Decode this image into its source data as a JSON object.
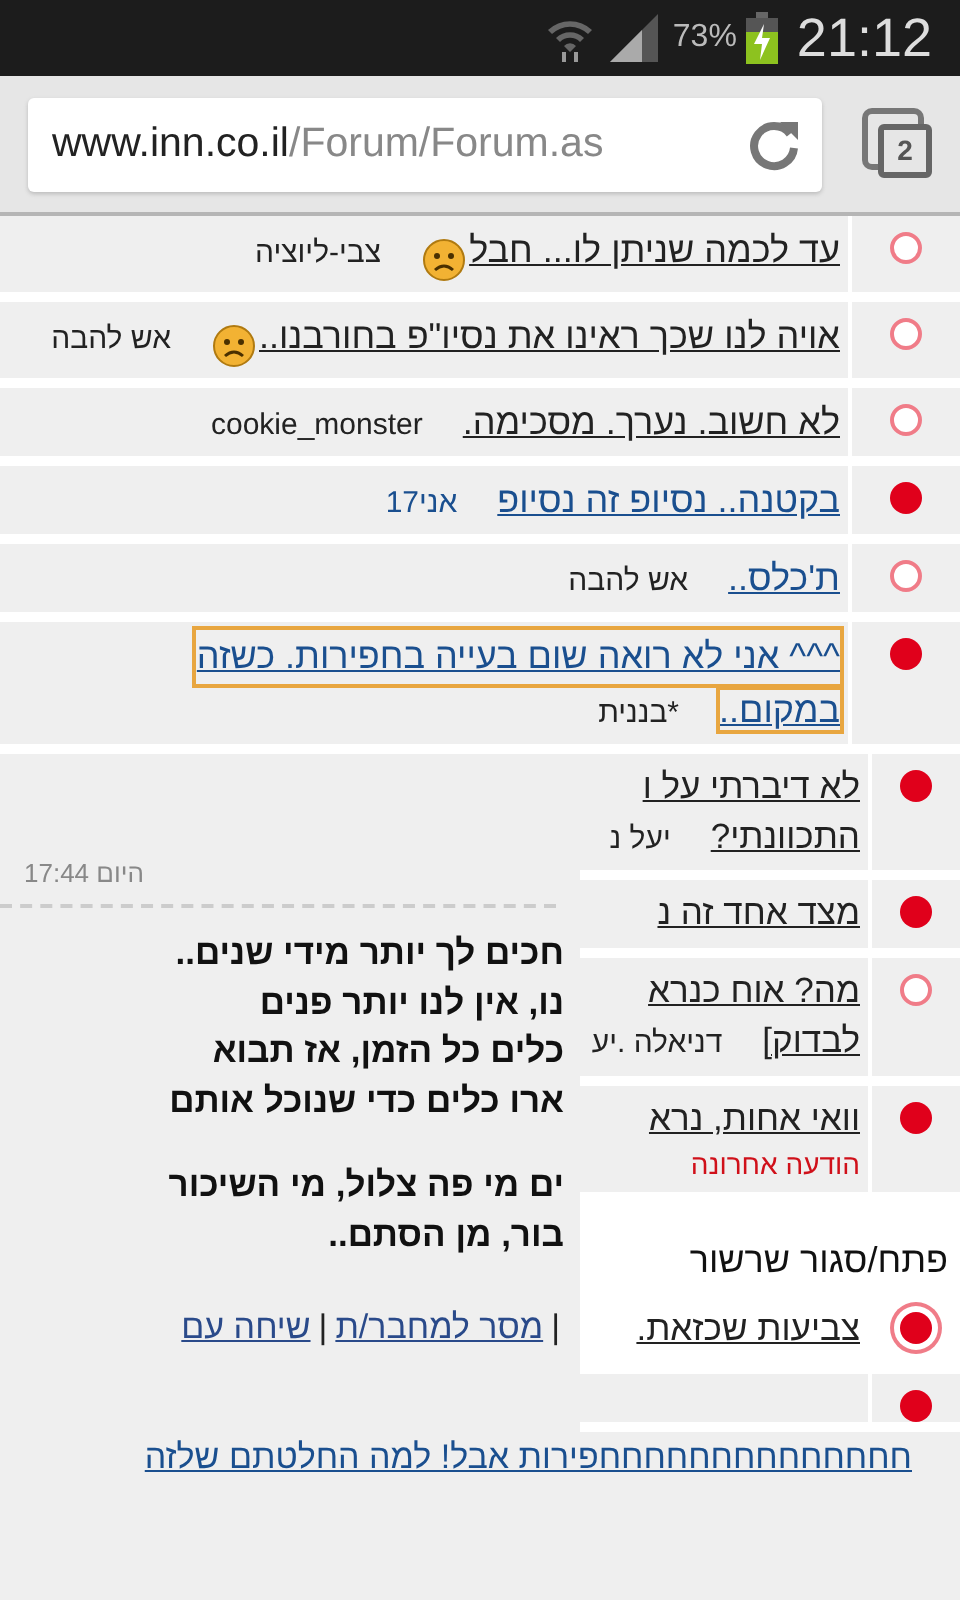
{
  "status_bar": {
    "battery": "73%",
    "time": "21:12"
  },
  "browser": {
    "url_host": "www.inn.co.il",
    "url_path": "/Forum/Forum.as",
    "tab_count": "2"
  },
  "threads": [
    {
      "title_lines": [
        "עד לכמה שניתן לו... חבל"
      ],
      "author": "צבי-ליוציה",
      "visited": true,
      "new": false,
      "selected": false,
      "focused": false,
      "smiley": true,
      "author_highlighted": false
    },
    {
      "title_lines": [
        "אויה לנו שכך ראינו את נסיו\"פ בחורבנו.."
      ],
      "author": "אש להבה",
      "visited": true,
      "new": false,
      "selected": false,
      "focused": false,
      "smiley": true,
      "author_highlighted": false
    },
    {
      "title_lines": [
        "לא חשוב. נערך. מסכימה."
      ],
      "author": "cookie_monster",
      "visited": true,
      "new": false,
      "selected": false,
      "focused": false,
      "smiley": false,
      "author_highlighted": false
    },
    {
      "title_lines": [
        "בקטנה.. נסיופ זה נסיופ"
      ],
      "author": "אני17",
      "visited": false,
      "new": true,
      "selected": false,
      "focused": false,
      "smiley": false,
      "author_highlighted": true
    },
    {
      "title_lines": [
        "ת'כלס.."
      ],
      "author": "אש להבה",
      "visited": false,
      "new": false,
      "selected": false,
      "focused": false,
      "smiley": false,
      "author_highlighted": false
    },
    {
      "title_lines": [
        "^^^ אני לא רואה שום בעייה בחפירות. כשזה",
        "במקום.."
      ],
      "author": "*בננית",
      "visited": false,
      "new": true,
      "selected": false,
      "focused": true,
      "smiley": false,
      "author_highlighted": false
    }
  ],
  "message_panel": {
    "time": "היום 17:44",
    "lines": [
      "חכים לך יותר מידי שנים..",
      "נו, אין לנו יותר פנים",
      "כלים כל הזמן, אז תבוא",
      "ארו כלים כדי שנוכל אותם",
      "ים מי פה צלול, מי השיכור",
      "בור, מן הסתם.."
    ],
    "links": [
      {
        "text": "|",
        "kind": "separator"
      },
      {
        "text": "מסר למחבר/ת",
        "kind": "link"
      },
      {
        "text": "|",
        "kind": "separator"
      },
      {
        "text": "שיחה עם",
        "kind": "link"
      }
    ]
  },
  "side_threads": [
    {
      "title_lines": [
        "לא דיברתי על ו",
        "התכוונתי?"
      ],
      "author": "יעל נ",
      "visited": true,
      "new": true,
      "selected": false
    },
    {
      "title_lines": [
        "מצד אחד זה נ"
      ],
      "visited": true,
      "new": true,
      "selected": false
    },
    {
      "title_lines": [
        "מה? אוח כנרא",
        "לבדוק]"
      ],
      "author": "דניאלה .יע",
      "visited": true,
      "new": false,
      "selected": false
    },
    {
      "title_lines": [
        "וואי אחות, נרא"
      ],
      "note": "הודעה אחרונה",
      "visited": true,
      "new": true,
      "selected": false
    }
  ],
  "toggle": "פתח/סגור שרשור",
  "current_thread": {
    "title_lines": [
      "צביעות שכזאת."
    ],
    "visited": true,
    "new": true,
    "selected": true
  },
  "bottom_thread": {
    "title": "חחחחחחחחחחחחחחפירות אבל! למה החלטתם שלזה",
    "visited": false,
    "new": true,
    "selected": false
  }
}
